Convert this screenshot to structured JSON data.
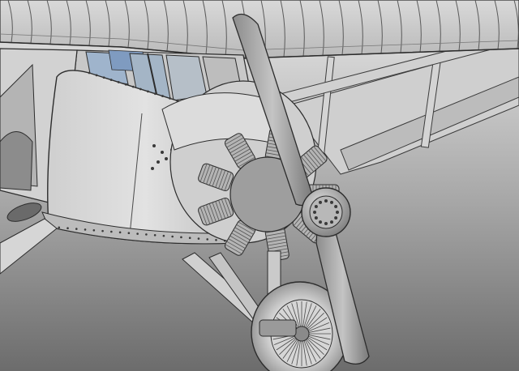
{
  "scene": {
    "subject": "3d-render-monoplane-radial-engine",
    "palette": {
      "background_top": "#e4e4e4",
      "background_bottom": "#6a6a6a",
      "metal_light": "#d6d6d6",
      "metal_mid": "#a8a8a8",
      "metal_dark": "#5e5e5e",
      "edge_line": "#2c2c2c",
      "glass": "#8ea6c4",
      "rivet": "#3a3a3a"
    }
  }
}
